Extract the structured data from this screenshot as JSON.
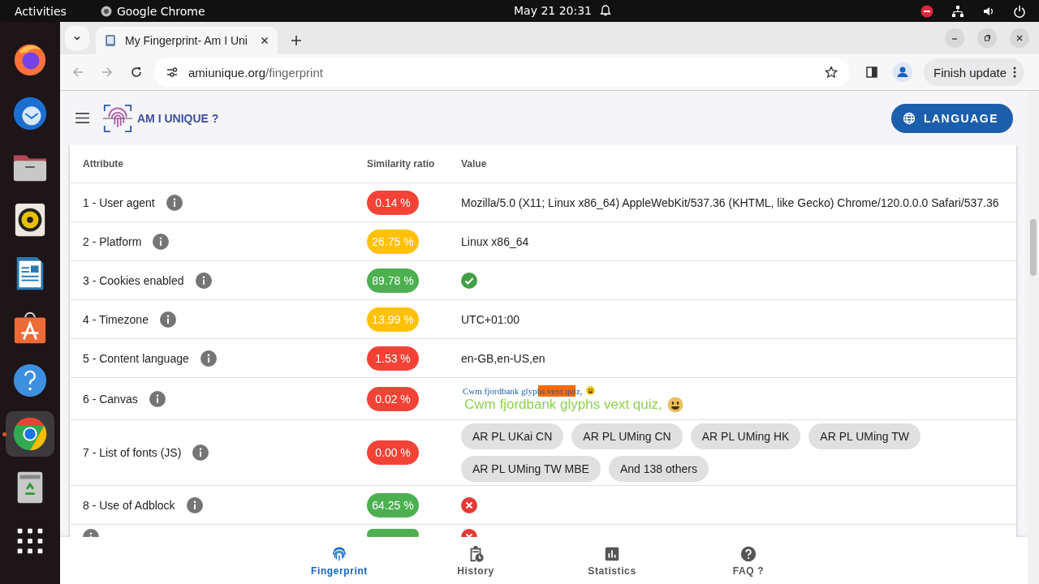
{
  "topbar": {
    "activities": "Activities",
    "app": "Google Chrome",
    "clock": "May 21  20:31"
  },
  "dock": [
    {
      "kind": "firefox",
      "selected": false
    },
    {
      "kind": "mail",
      "selected": false
    },
    {
      "kind": "files",
      "selected": false
    },
    {
      "kind": "speaker",
      "selected": false
    },
    {
      "kind": "writer",
      "selected": false
    },
    {
      "kind": "store",
      "selected": false
    },
    {
      "kind": "help",
      "selected": false
    },
    {
      "kind": "chrome",
      "selected": true
    },
    {
      "kind": "trash",
      "selected": false
    },
    {
      "kind": "apps",
      "selected": false
    }
  ],
  "browser": {
    "tab_title": "My Fingerprint- Am I Uni",
    "url_host": "amiunique.org",
    "url_path": "/fingerprint",
    "update_button": "Finish update"
  },
  "site": {
    "logo": "AM I UNIQUE ?",
    "language_button": "LANGUAGE"
  },
  "table": {
    "columns": [
      "Attribute",
      "Similarity ratio",
      "Value"
    ],
    "rows": [
      {
        "attribute": "1 - User agent",
        "ratio": "0.14 %",
        "color": "#f44336",
        "kind": "text",
        "value": "Mozilla/5.0 (X11; Linux x86_64) AppleWebKit/537.36 (KHTML, like Gecko) Chrome/120.0.0.0 Safari/537.36"
      },
      {
        "attribute": "2 - Platform",
        "ratio": "26.75 %",
        "color": "#ffc107",
        "kind": "text",
        "value": "Linux x86_64"
      },
      {
        "attribute": "3 - Cookies enabled",
        "ratio": "89.78 %",
        "color": "#4caf50",
        "kind": "check"
      },
      {
        "attribute": "4 - Timezone",
        "ratio": "13.99 %",
        "color": "#ffc107",
        "kind": "text",
        "value": "UTC+01:00"
      },
      {
        "attribute": "5 - Content language",
        "ratio": "1.53 %",
        "color": "#f44336",
        "kind": "text",
        "value": "en-GB,en-US,en"
      },
      {
        "attribute": "6 - Canvas",
        "ratio": "0.02 %",
        "color": "#f44336",
        "kind": "canvas",
        "lines": [
          "Cwm fjordbank glyphs vext quiz,",
          "Cwm fjordbank glyphs vext quiz,"
        ]
      },
      {
        "attribute": "7 - List of fonts (JS)",
        "ratio": "0.00 %",
        "color": "#f44336",
        "kind": "chips",
        "chips": [
          "AR PL UKai CN",
          "AR PL UMing CN",
          "AR PL UMing HK",
          "AR PL UMing TW",
          "AR PL UMing TW MBE",
          "And 138 others"
        ]
      },
      {
        "attribute": "8 - Use of Adblock",
        "ratio": "64.25 %",
        "color": "#4caf50",
        "kind": "cross"
      },
      {
        "color": "#4caf50",
        "kind": "cross"
      }
    ]
  },
  "nav": [
    {
      "label": "Fingerprint",
      "kind": "fingerprint",
      "selected": true
    },
    {
      "label": "History",
      "kind": "history",
      "selected": false
    },
    {
      "label": "Statistics",
      "kind": "stats",
      "selected": false
    },
    {
      "label": "FAQ ?",
      "kind": "faq",
      "selected": false
    }
  ]
}
